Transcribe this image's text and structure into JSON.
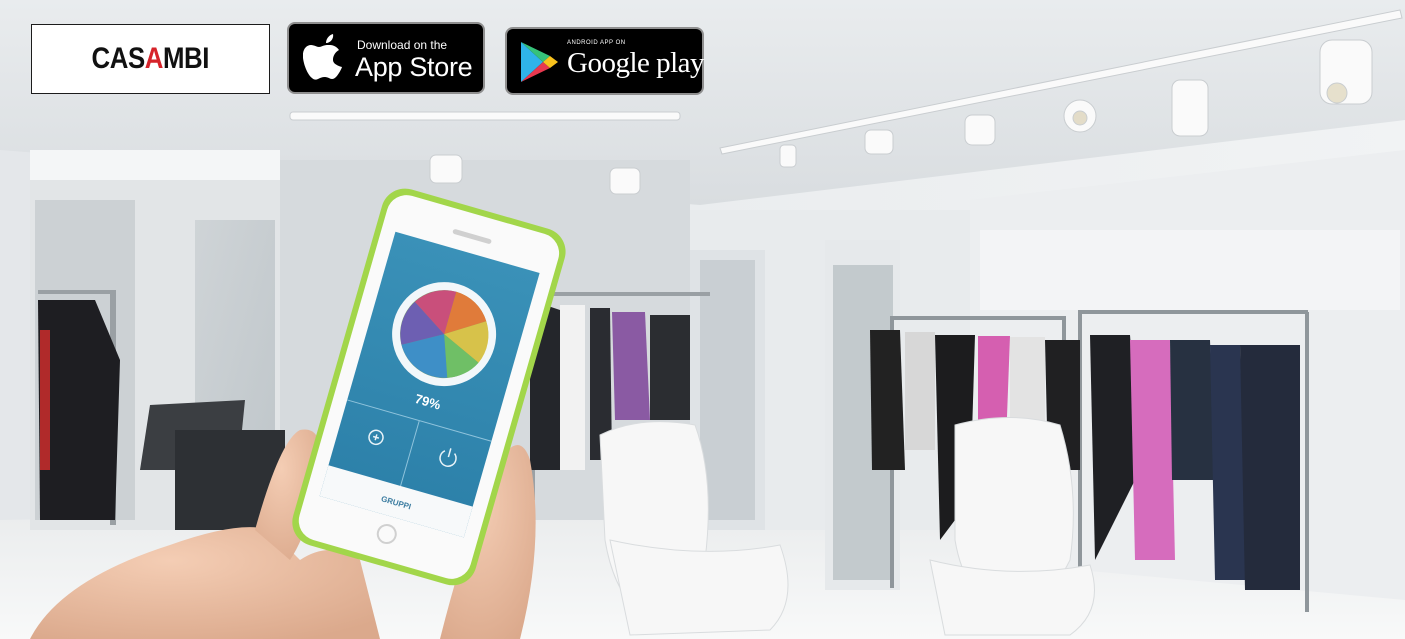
{
  "brand": {
    "name_pre": "CAS",
    "name_accent": "A",
    "name_post": "MBI",
    "accent_color": "#d6232a"
  },
  "app_store": {
    "line1": "Download on the",
    "line2": "App Store",
    "icon": "apple-icon"
  },
  "google_play": {
    "line1": "ANDROID APP ON",
    "line2": "Google play",
    "icon": "google-play-icon"
  },
  "phone_app": {
    "brightness_level": "79%",
    "tab_label": "GRUPPI",
    "left_control_icon": "plus-circle-icon",
    "right_control_icon": "power-icon",
    "accent_color": "#2f89b3"
  }
}
